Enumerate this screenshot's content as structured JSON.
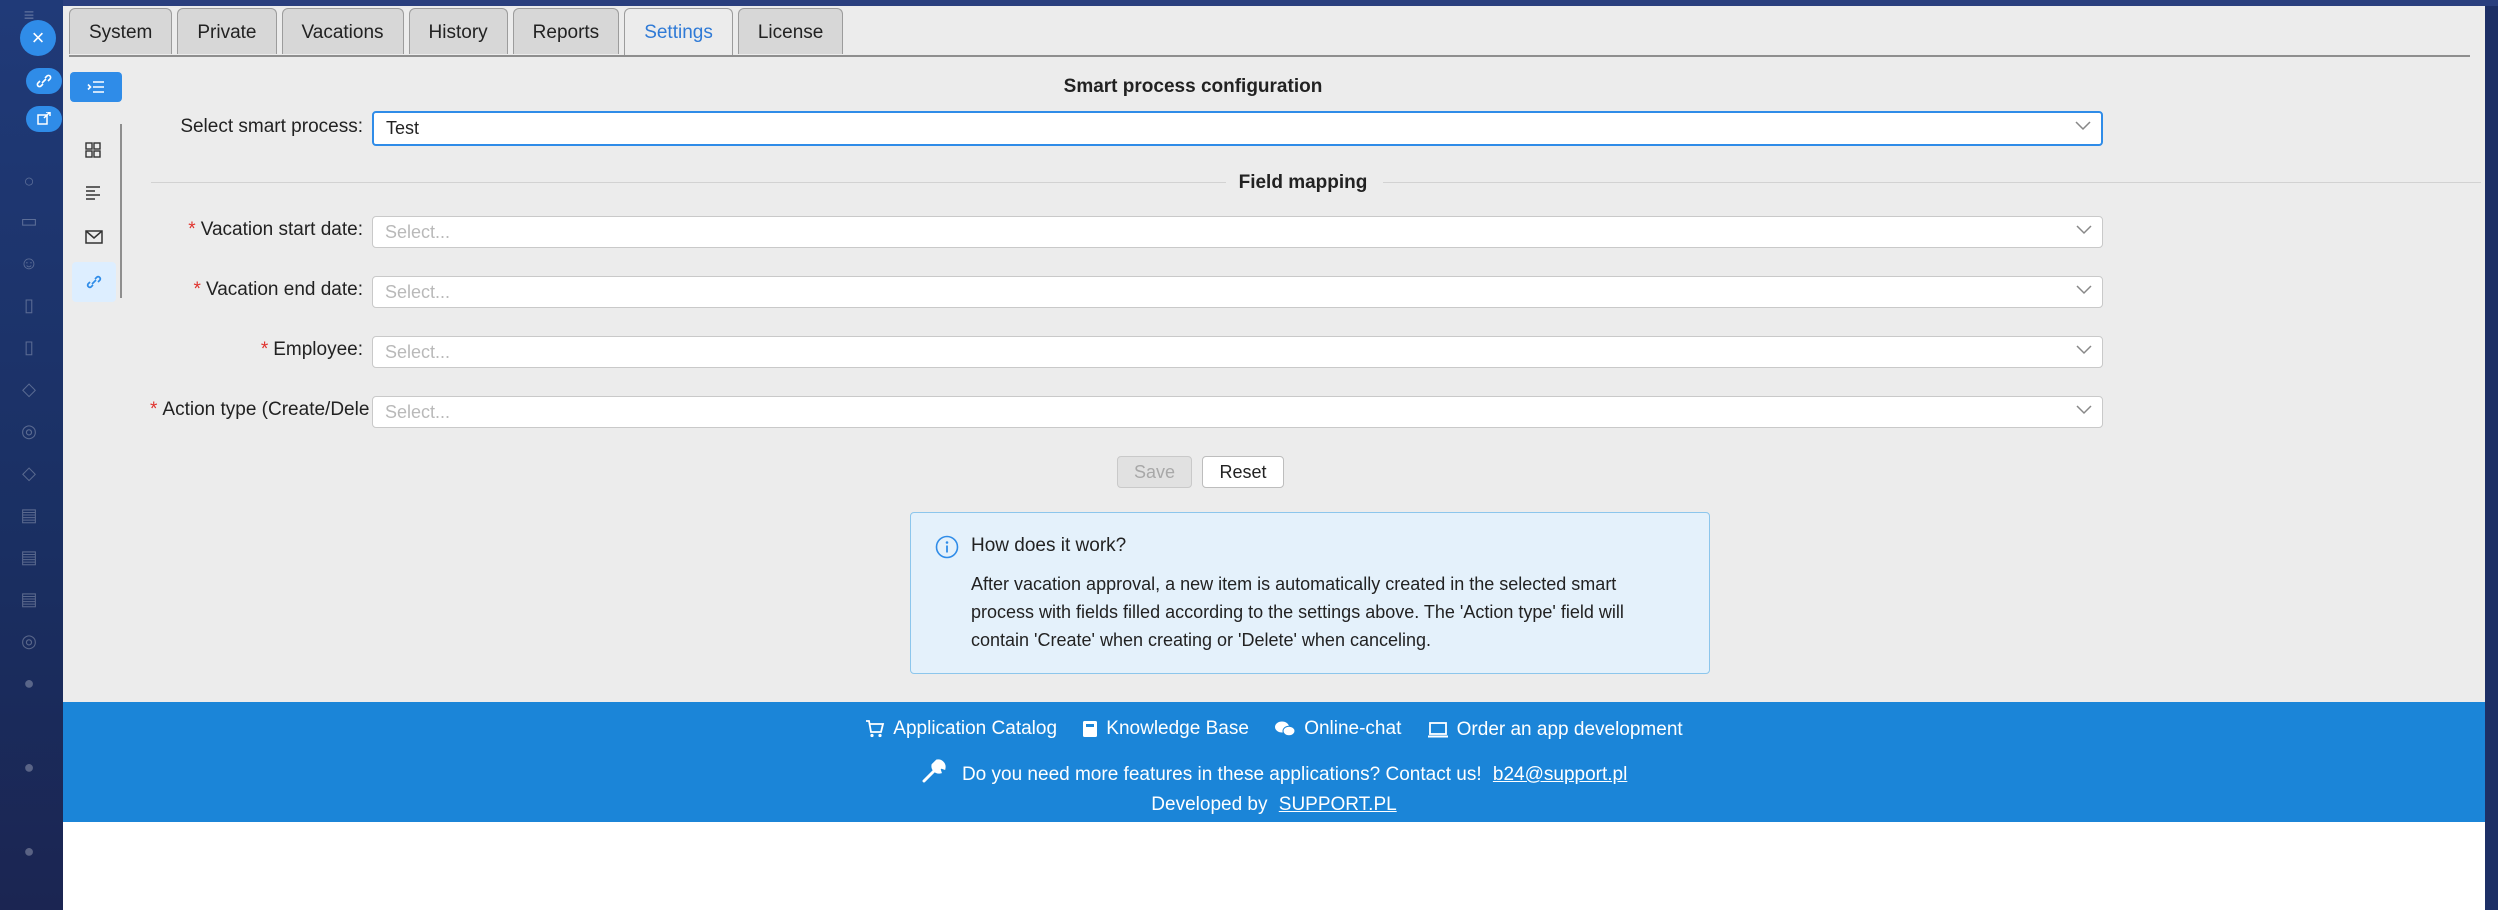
{
  "tabs": [
    {
      "label": "System"
    },
    {
      "label": "Private"
    },
    {
      "label": "Vacations"
    },
    {
      "label": "History"
    },
    {
      "label": "Reports"
    },
    {
      "label": "Settings"
    },
    {
      "label": "License"
    }
  ],
  "active_tab": "Settings",
  "smart_process": {
    "section_title": "Smart process configuration",
    "select_label": "Select smart process",
    "selected_value": "Test"
  },
  "field_mapping": {
    "section_title": "Field mapping",
    "fields": [
      {
        "label": "Vacation start date",
        "placeholder": "Select...",
        "required": true
      },
      {
        "label": "Vacation end date",
        "placeholder": "Select...",
        "required": true
      },
      {
        "label": "Employee",
        "placeholder": "Select...",
        "required": true
      },
      {
        "label": "Action type (Create/Dele",
        "placeholder": "Select...",
        "required": true
      }
    ]
  },
  "buttons": {
    "save": "Save",
    "reset": "Reset"
  },
  "info": {
    "title": "How does it work?",
    "text": "After vacation approval, a new item is automatically created in the selected smart process with fields filled according to the settings above. The 'Action type' field will contain 'Create' when creating or 'Delete' when canceling."
  },
  "footer": {
    "links": [
      "Application Catalog",
      "Knowledge Base",
      "Online-chat",
      "Order an app development"
    ],
    "contact_text": "Do you need more features in these applications? Contact us!",
    "contact_email": "b24@support.pl",
    "developed_by": "Developed by",
    "developer": "SUPPORT.PL"
  },
  "colors": {
    "accent": "#2f8ce8",
    "footer": "#1b85d8",
    "required": "#e0322d"
  }
}
